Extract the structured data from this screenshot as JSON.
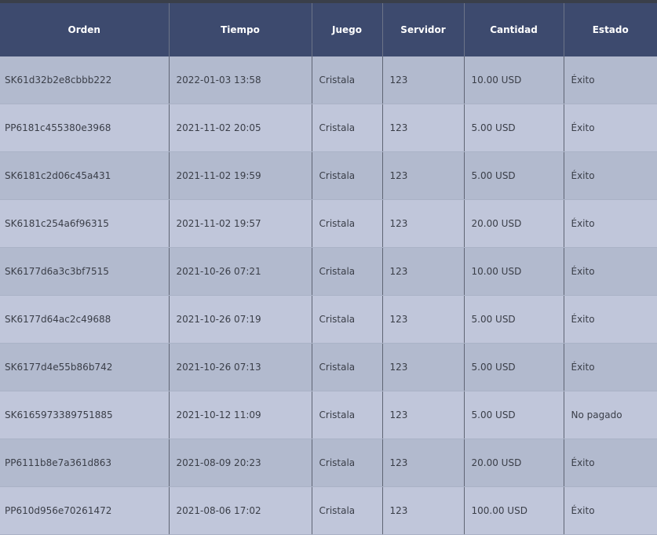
{
  "table": {
    "headers": {
      "orden": "Orden",
      "tiempo": "Tiempo",
      "juego": "Juego",
      "servidor": "Servidor",
      "cantidad": "Cantidad",
      "estado": "Estado"
    },
    "rows": [
      {
        "orden": "SK61d32b2e8cbbb222",
        "tiempo": "2022-01-03 13:58",
        "juego": "Cristala",
        "servidor": "123",
        "cantidad": "10.00 USD",
        "estado": "Éxito"
      },
      {
        "orden": "PP6181c455380e3968",
        "tiempo": "2021-11-02 20:05",
        "juego": "Cristala",
        "servidor": "123",
        "cantidad": "5.00 USD",
        "estado": "Éxito"
      },
      {
        "orden": "SK6181c2d06c45a431",
        "tiempo": "2021-11-02 19:59",
        "juego": "Cristala",
        "servidor": "123",
        "cantidad": "5.00 USD",
        "estado": "Éxito"
      },
      {
        "orden": "SK6181c254a6f96315",
        "tiempo": "2021-11-02 19:57",
        "juego": "Cristala",
        "servidor": "123",
        "cantidad": "20.00 USD",
        "estado": "Éxito"
      },
      {
        "orden": "SK6177d6a3c3bf7515",
        "tiempo": "2021-10-26 07:21",
        "juego": "Cristala",
        "servidor": "123",
        "cantidad": "10.00 USD",
        "estado": "Éxito"
      },
      {
        "orden": "SK6177d64ac2c49688",
        "tiempo": "2021-10-26 07:19",
        "juego": "Cristala",
        "servidor": "123",
        "cantidad": "5.00 USD",
        "estado": "Éxito"
      },
      {
        "orden": "SK6177d4e55b86b742",
        "tiempo": "2021-10-26 07:13",
        "juego": "Cristala",
        "servidor": "123",
        "cantidad": "5.00 USD",
        "estado": "Éxito"
      },
      {
        "orden": "SK6165973389751885",
        "tiempo": "2021-10-12 11:09",
        "juego": "Cristala",
        "servidor": "123",
        "cantidad": "5.00 USD",
        "estado": "No pagado"
      },
      {
        "orden": "PP6111b8e7a361d863",
        "tiempo": "2021-08-09 20:23",
        "juego": "Cristala",
        "servidor": "123",
        "cantidad": "20.00 USD",
        "estado": "Éxito"
      },
      {
        "orden": "PP610d956e70261472",
        "tiempo": "2021-08-06 17:02",
        "juego": "Cristala",
        "servidor": "123",
        "cantidad": "100.00 USD",
        "estado": "Éxito"
      }
    ]
  },
  "colors": {
    "header_bg": "#3d4a6e",
    "row_odd": "#b2bace",
    "row_even": "#c0c6da"
  }
}
